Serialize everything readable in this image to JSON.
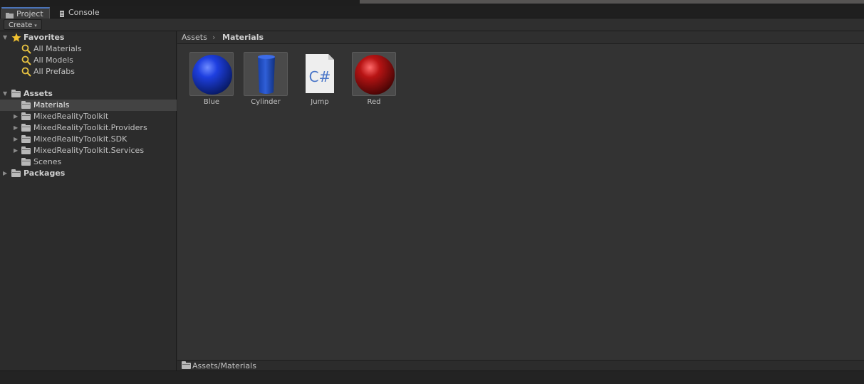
{
  "tabs": [
    {
      "label": "Project",
      "icon": "folder-icon"
    },
    {
      "label": "Console",
      "icon": "console-icon"
    }
  ],
  "toolbar": {
    "create_label": "Create",
    "create_caret": "▾"
  },
  "favorites": {
    "title": "Favorites",
    "items": [
      "All Materials",
      "All Models",
      "All Prefabs"
    ]
  },
  "assets": {
    "title": "Assets",
    "children": [
      {
        "label": "Materials",
        "selected": true
      },
      {
        "label": "MixedRealityToolkit",
        "expandable": true
      },
      {
        "label": "MixedRealityToolkit.Providers",
        "expandable": true
      },
      {
        "label": "MixedRealityToolkit.SDK",
        "expandable": true
      },
      {
        "label": "MixedRealityToolkit.Services",
        "expandable": true
      },
      {
        "label": "Scenes"
      }
    ]
  },
  "packages": {
    "title": "Packages"
  },
  "breadcrumb": {
    "root": "Assets",
    "separator": "›",
    "current": "Materials"
  },
  "grid": {
    "items": [
      {
        "name": "Blue",
        "icon": "blue-sphere-material-icon"
      },
      {
        "name": "Cylinder",
        "icon": "cylinder-model-icon"
      },
      {
        "name": "Jump",
        "icon": "csharp-script-icon",
        "glyph": "C#"
      },
      {
        "name": "Red",
        "icon": "red-sphere-material-icon"
      }
    ]
  },
  "status": {
    "path": "Assets/Materials"
  },
  "colors": {
    "selection_tab_accent": "#4a73b8",
    "favorite_star": "#f2c230",
    "search_icon": "#e8c341"
  }
}
